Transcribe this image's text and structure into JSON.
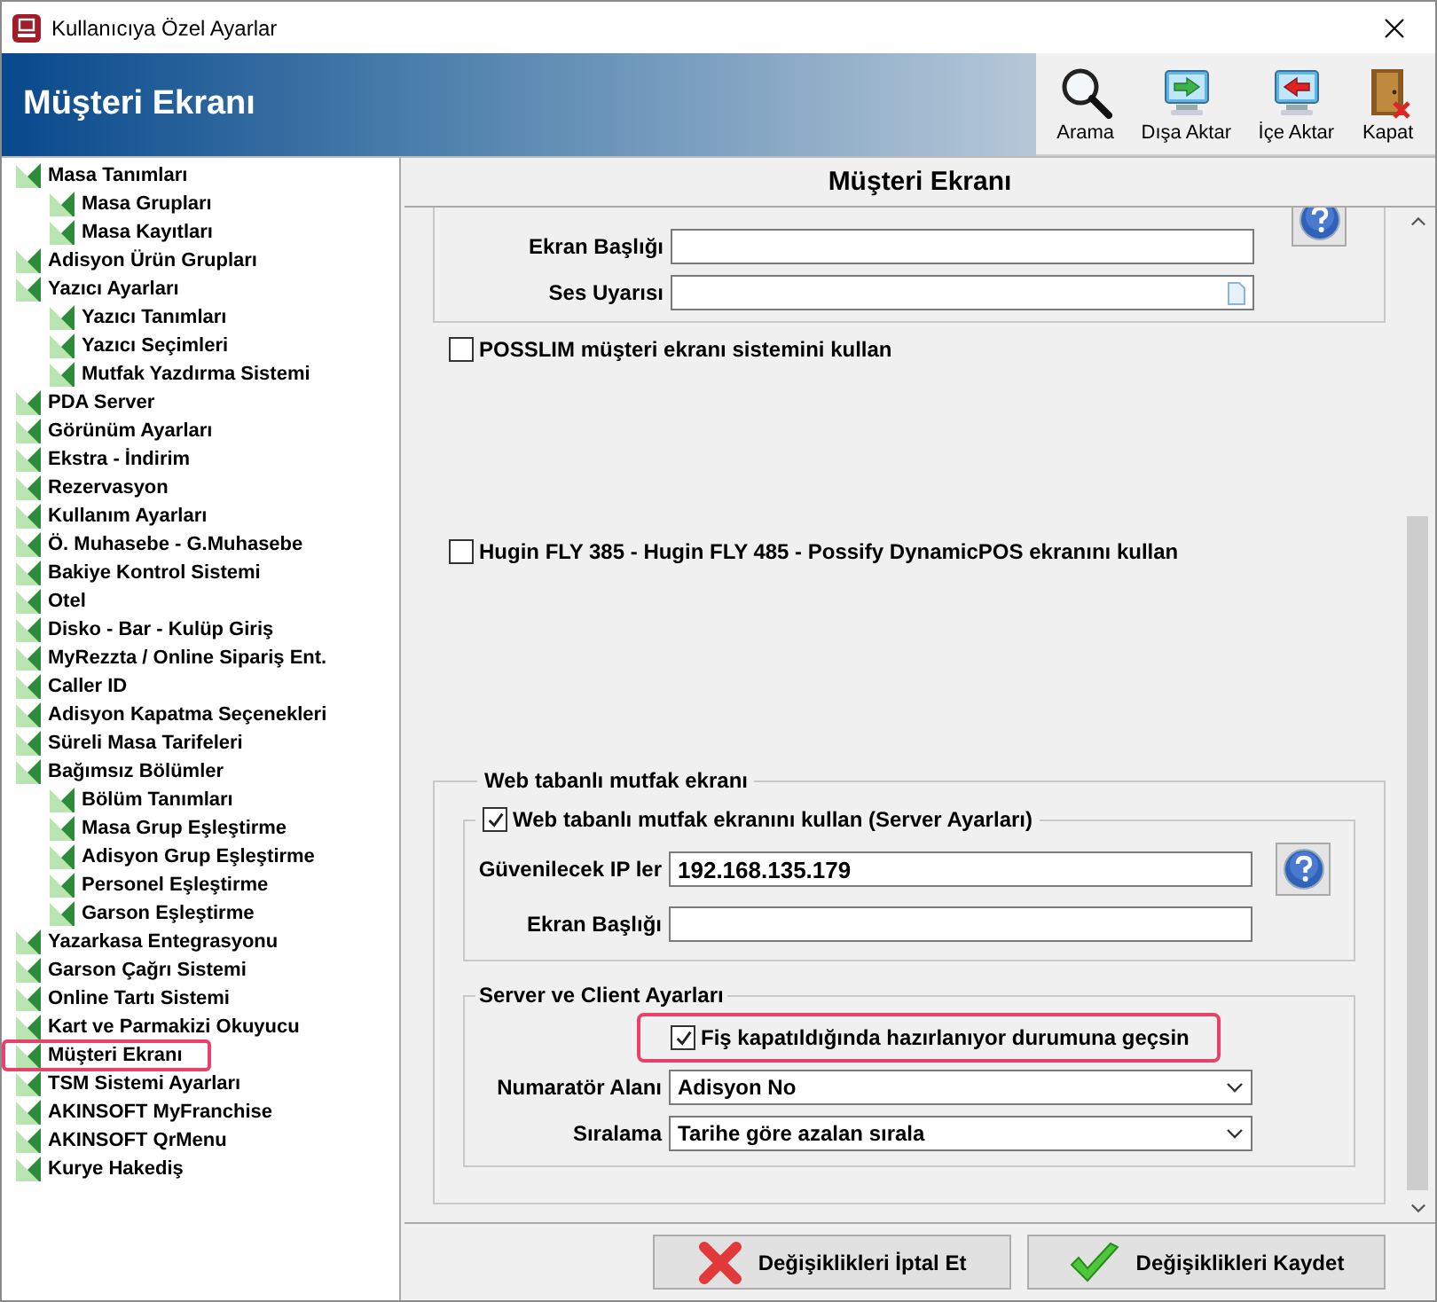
{
  "window": {
    "title": "Kullanıcıya Özel Ayarlar"
  },
  "header": {
    "title": "Müşteri Ekranı"
  },
  "toolbar": [
    {
      "kind": "search",
      "label": "Arama"
    },
    {
      "kind": "export",
      "label": "Dışa Aktar"
    },
    {
      "kind": "import",
      "label": "İçe Aktar"
    },
    {
      "kind": "close",
      "label": "Kapat"
    }
  ],
  "tree": [
    {
      "label": "Masa Tanımları",
      "highlighted": false,
      "children": [
        {
          "label": "Masa Grupları",
          "highlighted": false
        },
        {
          "label": "Masa Kayıtları",
          "highlighted": false
        }
      ]
    },
    {
      "label": "Adisyon Ürün Grupları",
      "highlighted": false
    },
    {
      "label": "Yazıcı Ayarları",
      "highlighted": false,
      "children": [
        {
          "label": "Yazıcı Tanımları",
          "highlighted": false
        },
        {
          "label": "Yazıcı Seçimleri",
          "highlighted": false
        },
        {
          "label": "Mutfak Yazdırma Sistemi",
          "highlighted": false
        }
      ]
    },
    {
      "label": "PDA Server",
      "highlighted": false
    },
    {
      "label": "Görünüm Ayarları",
      "highlighted": false
    },
    {
      "label": "Ekstra - İndirim",
      "highlighted": false
    },
    {
      "label": "Rezervasyon",
      "highlighted": false
    },
    {
      "label": "Kullanım Ayarları",
      "highlighted": false
    },
    {
      "label": "Ö. Muhasebe - G.Muhasebe",
      "highlighted": false
    },
    {
      "label": "Bakiye Kontrol Sistemi",
      "highlighted": false
    },
    {
      "label": "Otel",
      "highlighted": false
    },
    {
      "label": "Disko - Bar - Kulüp Giriş",
      "highlighted": false
    },
    {
      "label": "MyRezzta / Online Sipariş Ent.",
      "highlighted": false
    },
    {
      "label": "Caller ID",
      "highlighted": false
    },
    {
      "label": "Adisyon Kapatma Seçenekleri",
      "highlighted": false
    },
    {
      "label": "Süreli Masa Tarifeleri",
      "highlighted": false
    },
    {
      "label": "Bağımsız Bölümler",
      "highlighted": false,
      "children": [
        {
          "label": "Bölüm Tanımları",
          "highlighted": false
        },
        {
          "label": "Masa Grup Eşleştirme",
          "highlighted": false
        },
        {
          "label": "Adisyon Grup Eşleştirme",
          "highlighted": false
        },
        {
          "label": "Personel Eşleştirme",
          "highlighted": false
        },
        {
          "label": "Garson Eşleştirme",
          "highlighted": false
        }
      ]
    },
    {
      "label": "Yazarkasa Entegrasyonu",
      "highlighted": false
    },
    {
      "label": "Garson Çağrı Sistemi",
      "highlighted": false
    },
    {
      "label": "Online Tartı Sistemi",
      "highlighted": false
    },
    {
      "label": "Kart ve Parmakizi Okuyucu",
      "highlighted": false
    },
    {
      "label": "Müşteri Ekranı",
      "highlighted": true
    },
    {
      "label": "TSM Sistemi Ayarları",
      "highlighted": false
    },
    {
      "label": "AKINSOFT MyFranchise",
      "highlighted": false
    },
    {
      "label": "AKINSOFT QrMenu",
      "highlighted": false
    },
    {
      "label": "Kurye Hakediş",
      "highlighted": false
    }
  ],
  "panel": {
    "title": "Müşteri Ekranı",
    "top_fields": [
      {
        "kind": "text",
        "label": "Ekran Başlığı"
      },
      {
        "kind": "file",
        "label": "Ses Uyarısı"
      }
    ],
    "options": [
      {
        "label": "POSSLIM müşteri ekranı sistemini kullan",
        "checked": false
      },
      {
        "label": "Hugin FLY 385 - Hugin FLY 485 - Possify DynamicPOS ekranını kullan",
        "checked": false
      }
    ],
    "web_group": {
      "title": "Web tabanlı mutfak ekranı",
      "server": {
        "label": "Web tabanlı mutfak ekranını kullan (Server Ayarları)",
        "checked": true,
        "fields": [
          {
            "label": "Güvenilecek IP ler",
            "value": "192.168.135.179"
          },
          {
            "label": "Ekran Başlığı"
          }
        ]
      },
      "client": {
        "title": "Server ve Client Ayarları",
        "option": {
          "label": "Fiş kapatıldığında hazırlanıyor durumuna geçsin",
          "checked": true,
          "highlighted": true
        },
        "selects": [
          {
            "label": "Numaratör Alanı",
            "value": "Adisyon No"
          },
          {
            "label": "Sıralama",
            "value": "Tarihe göre azalan sırala"
          }
        ]
      }
    }
  },
  "buttons": [
    {
      "kind": "cancel",
      "label": "Değişiklikleri İptal Et"
    },
    {
      "kind": "save",
      "label": "Değişiklikleri Kaydet"
    }
  ]
}
